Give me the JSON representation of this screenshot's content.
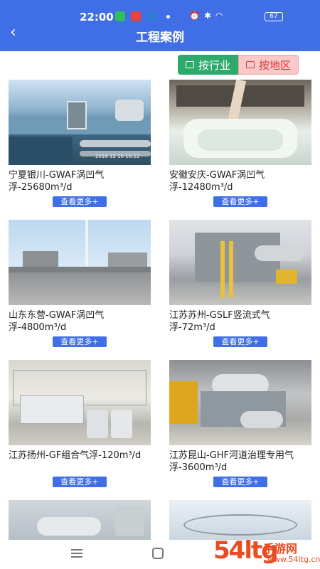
{
  "status": {
    "time": "22:00",
    "battery": "67"
  },
  "header": {
    "title": "工程案例",
    "back_icon": "chevron-left-icon"
  },
  "filters": {
    "industry_label": "按行业",
    "region_label": "按地区",
    "industry_color": "#2daa6b",
    "region_color": "#f9c9c9"
  },
  "cases": [
    {
      "title": "宁夏银川-GWAF涡凹气浮-25680m³/d",
      "more": "查看更多+",
      "photo_stamp": "2016 12 10 16:12"
    },
    {
      "title": "安徽安庆-GWAF涡凹气浮-12480m³/d",
      "more": "查看更多+"
    },
    {
      "title": "山东东营-GWAF涡凹气浮-4800m³/d",
      "more": "查看更多+"
    },
    {
      "title": "江苏苏州-GSLF竖流式气浮-72m³/d",
      "more": "查看更多+"
    },
    {
      "title": "江苏扬州-GF组合气浮-120m³/d",
      "more": "查看更多+"
    },
    {
      "title": "江苏昆山-GHF河道治理专用气浮-3600m³/d",
      "more": "查看更多+"
    }
  ],
  "watermark": {
    "num": "54ltg",
    "text": "手游网",
    "sub": "www.54ltg.cn"
  },
  "accent": "#3f6ee6"
}
